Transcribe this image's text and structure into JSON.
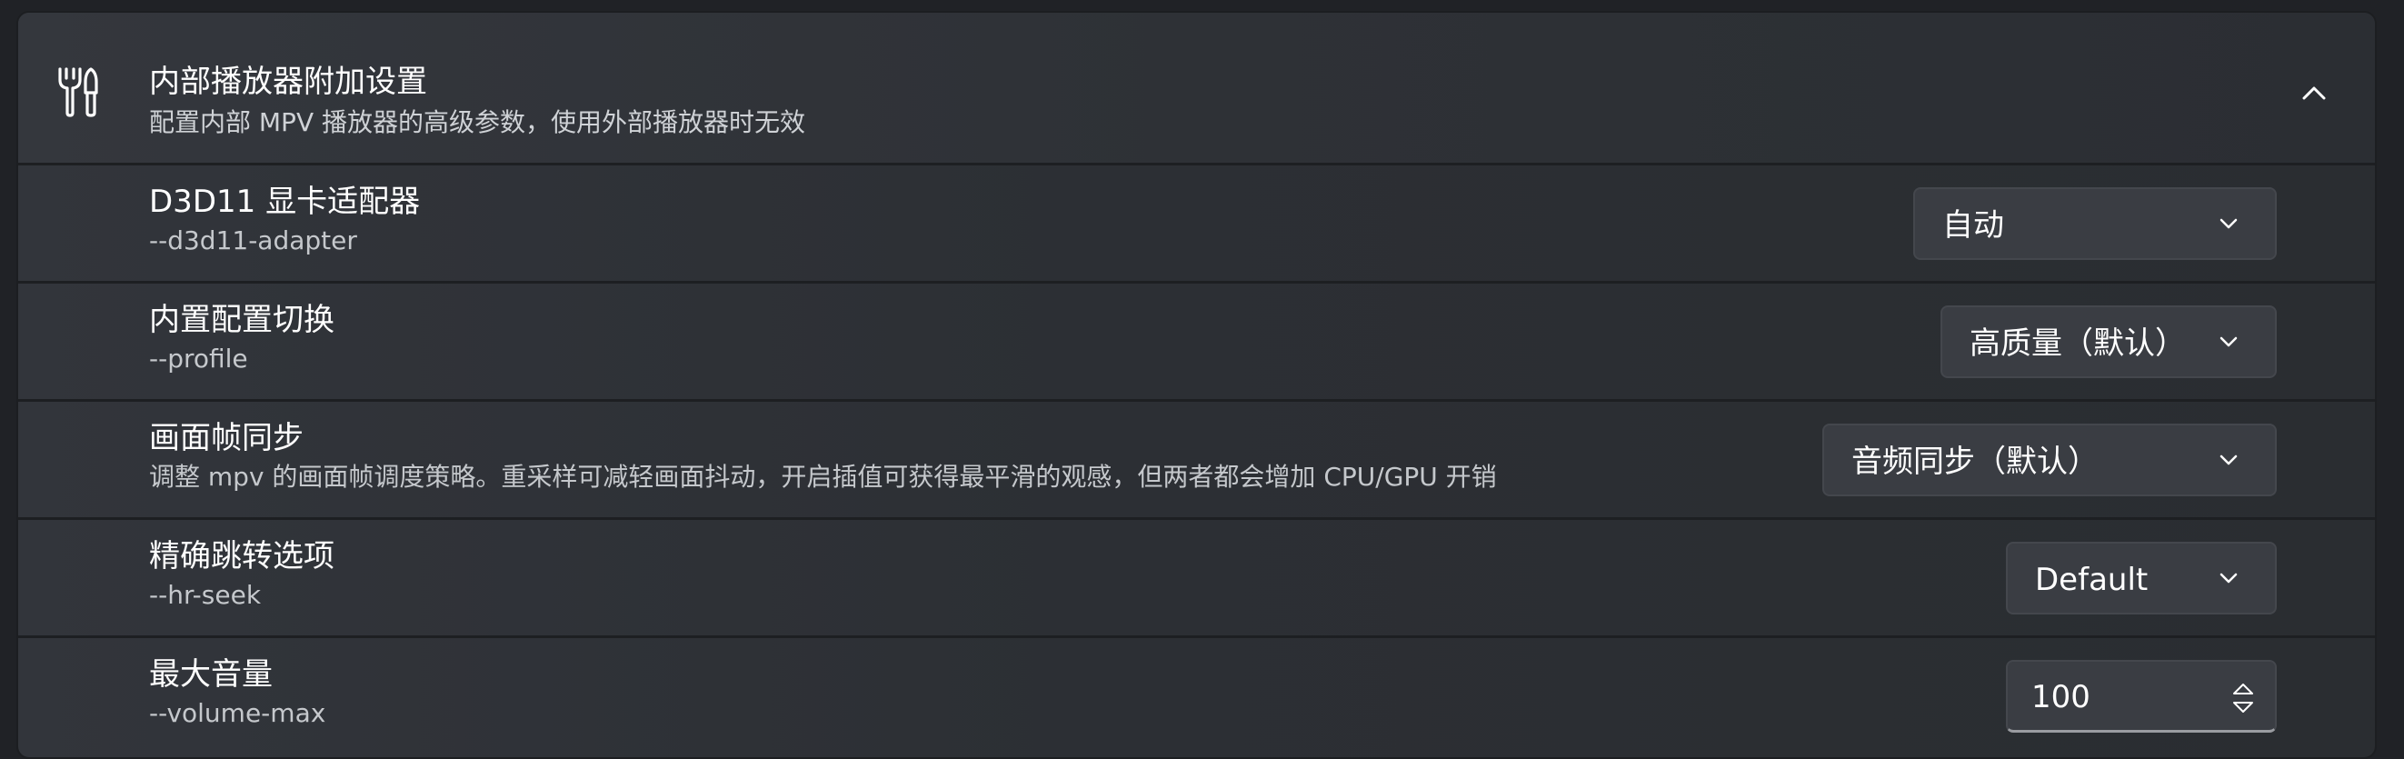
{
  "section": {
    "icon": "wrench-screwdriver-icon",
    "title": "内部播放器附加设置",
    "description": "配置内部 MPV 播放器的高级参数，使用外部播放器时无效",
    "collapse_icon": "chevron-up-icon"
  },
  "settings": [
    {
      "title": "D3D11 显卡适配器",
      "subtitle": "--d3d11-adapter",
      "control": "dropdown",
      "value": "自动"
    },
    {
      "title": "内置配置切换",
      "subtitle": "--profile",
      "control": "dropdown",
      "value": "高质量（默认）"
    },
    {
      "title": "画面帧同步",
      "subtitle": "调整 mpv 的画面帧调度策略。重采样可减轻画面抖动，开启插值可获得最平滑的观感，但两者都会增加 CPU/GPU 开销",
      "control": "dropdown",
      "value": "音频同步（默认）"
    },
    {
      "title": "精确跳转选项",
      "subtitle": "--hr-seek",
      "control": "dropdown",
      "value": "Default"
    },
    {
      "title": "最大音量",
      "subtitle": "--volume-max",
      "control": "number",
      "value": "100"
    }
  ],
  "colors": {
    "background": "#202226",
    "card": "#2e3136",
    "control": "#3a3d43",
    "text_primary": "#ffffff",
    "text_secondary": "#c5c8cc"
  }
}
